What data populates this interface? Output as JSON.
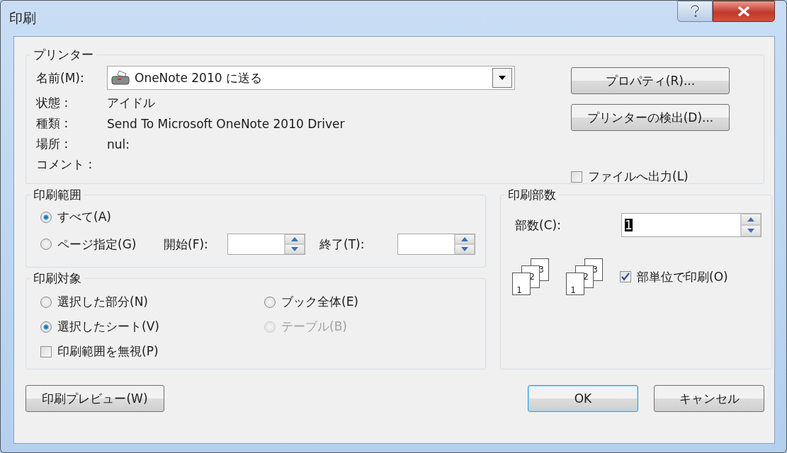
{
  "window": {
    "title": "印刷"
  },
  "printer": {
    "legend": "プリンター",
    "name_label": "名前(M):",
    "name_value": "OneNote 2010 に送る",
    "details": [
      {
        "label": "状態 :",
        "value": "アイドル"
      },
      {
        "label": "種類 :",
        "value": "Send To Microsoft OneNote 2010 Driver"
      },
      {
        "label": "場所 :",
        "value": "nul:"
      },
      {
        "label": "コメント :"
      }
    ],
    "buttons": [
      "プロパティ(R)...",
      "プリンターの検出(D)..."
    ],
    "print_to_file": {
      "label": "ファイルへ出力(L)",
      "checked": false
    }
  },
  "print_range": {
    "legend": "印刷範囲",
    "options": [
      {
        "label": "すべて(A)",
        "selected": true
      },
      {
        "label": "ページ指定(G)",
        "selected": false
      }
    ],
    "from_label": "開始(F):",
    "to_label": "終了(T):"
  },
  "print_what": {
    "legend": "印刷対象",
    "options": [
      {
        "label": "選択した部分(N)",
        "selected": false,
        "disabled": false
      },
      {
        "label": "ブック全体(E)",
        "selected": false,
        "disabled": false
      },
      {
        "label": "選択したシート(V)",
        "selected": true,
        "disabled": false
      },
      {
        "label": "テーブル(B)",
        "selected": false,
        "disabled": true
      }
    ],
    "ignore_print_areas": {
      "label": "印刷範囲を無視(P)",
      "checked": false
    }
  },
  "copies": {
    "legend": "印刷部数",
    "count_label": "部数(C):",
    "count_value": "1",
    "value_highlighted": true,
    "page_stacks": [
      [
        "1",
        "2",
        "3"
      ],
      [
        "1",
        "2",
        "3"
      ]
    ],
    "collate": {
      "label": "部単位で印刷(O)",
      "checked": true
    }
  },
  "preview_button": "印刷プレビュー(W)",
  "action_buttons": [
    {
      "label": "OK",
      "default": true
    },
    {
      "label": "キャンセル",
      "default": false
    }
  ]
}
